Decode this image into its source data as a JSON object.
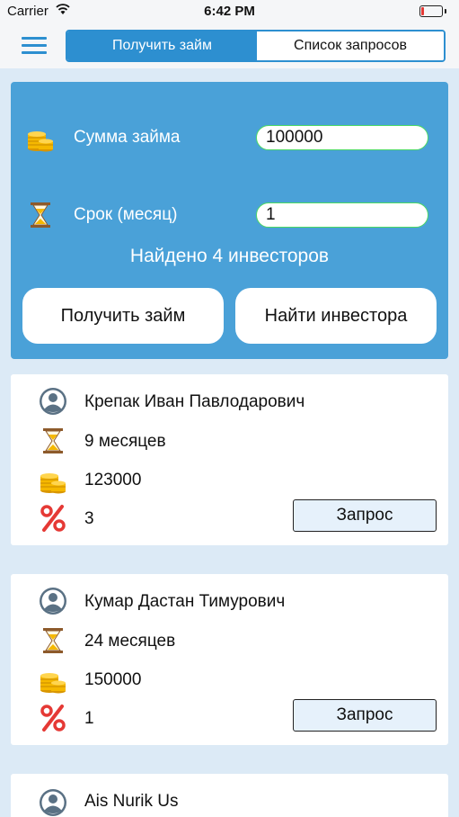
{
  "status_bar": {
    "carrier": "Carrier",
    "time": "6:42 PM"
  },
  "nav": {
    "tabs": [
      {
        "label": "Получить займ",
        "active": true
      },
      {
        "label": "Список запросов",
        "active": false
      }
    ]
  },
  "form": {
    "amount_label": "Сумма займа",
    "amount_value": "100000",
    "term_label": "Срок (месяц)",
    "term_value": "1",
    "found_text": "Найдено 4 инвесторов",
    "get_loan_label": "Получить займ",
    "find_investor_label": "Найти инвестора"
  },
  "investors": [
    {
      "name": "Крепак Иван Павлодарович",
      "term": "9 месяцев",
      "amount": "123000",
      "rate": "3",
      "request_label": "Запрос"
    },
    {
      "name": "Кумар Дастан Тимурович",
      "term": "24 месяцев",
      "amount": "150000",
      "rate": "1",
      "request_label": "Запрос"
    },
    {
      "name": "Ais Nurik Us"
    }
  ],
  "colors": {
    "accent": "#2d8fd0",
    "panel": "#4aa1d8",
    "background": "#dceaf6",
    "input_border": "#4cd964",
    "percent_icon": "#e53935",
    "coins": "#f5b800"
  },
  "icons": [
    "menu-icon",
    "coins-icon",
    "hourglass-icon",
    "user-avatar-icon",
    "percent-icon",
    "wifi-icon",
    "battery-icon"
  ]
}
